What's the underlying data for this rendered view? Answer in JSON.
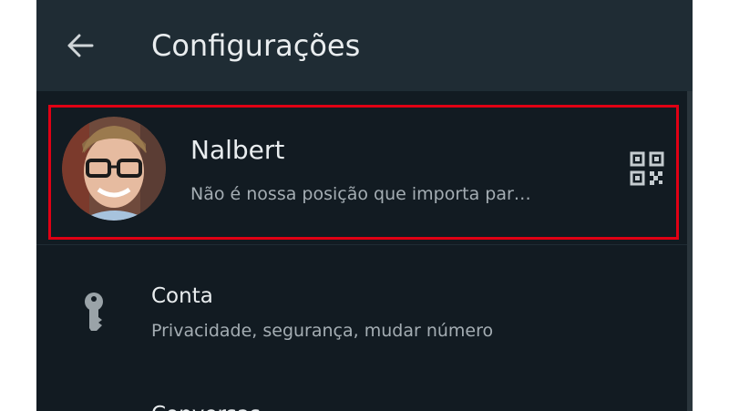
{
  "header": {
    "title": "Configurações",
    "back_icon": "arrow-left-icon"
  },
  "profile": {
    "name": "Nalbert",
    "status": "Não é nossa posição que importa par…",
    "qr_icon": "qr-code-icon",
    "highlight_color": "#e00014"
  },
  "settings": {
    "items": [
      {
        "title": "Conta",
        "subtitle": "Privacidade, segurança, mudar número",
        "icon": "key-icon"
      },
      {
        "title": "Conversas"
      }
    ]
  },
  "colors": {
    "background": "#121b22",
    "appbar": "#1f2c34",
    "primary_text": "#e9edef",
    "secondary_text": "#a4adb3"
  }
}
